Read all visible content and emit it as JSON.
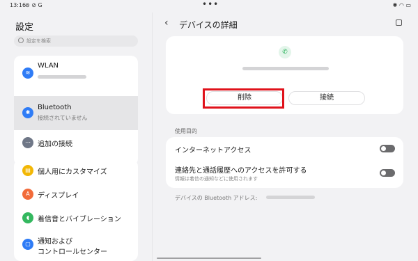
{
  "status": {
    "time": "13:16",
    "left_icons": "⊚ ⊘ G",
    "dots": "•••",
    "right_icons": "✱ ◠ ▭"
  },
  "sidebar": {
    "title": "設定",
    "search_placeholder": "設定を検索",
    "items": [
      {
        "label": "WLAN",
        "sub": "",
        "icon": "wifi-icon",
        "color": "#2f7cf6"
      },
      {
        "label": "Bluetooth",
        "sub": "接続されていません",
        "icon": "bluetooth-icon",
        "color": "#2f7cf6"
      },
      {
        "label": "追加の接続",
        "sub": "",
        "icon": "more-icon",
        "color": "#6f7787"
      },
      {
        "label": "個人用にカスタマイズ",
        "sub": "",
        "icon": "customize-icon",
        "color": "#f2b705"
      },
      {
        "label": "ディスプレイ",
        "sub": "",
        "icon": "display-icon",
        "color": "#f26b3a"
      },
      {
        "label": "着信音とバイブレーション",
        "sub": "",
        "icon": "sound-icon",
        "color": "#34b85f"
      },
      {
        "label": "通知および",
        "sub": "コントロールセンター",
        "icon": "notification-icon",
        "color": "#2f7cf6"
      }
    ],
    "icon_glyphs": [
      "≋",
      "✱",
      "⋯",
      "▤",
      "A",
      "◖",
      "▢"
    ]
  },
  "detail": {
    "title": "デバイスの詳細",
    "delete_label": "削除",
    "connect_label": "接続",
    "section_label": "使用目的",
    "options": [
      {
        "label": "インターネットアクセス",
        "sub": "",
        "enabled": false
      },
      {
        "label": "連絡先と通話履歴へのアクセスを許可する",
        "sub": "情報は着信の通知などに使用されます",
        "enabled": false
      }
    ],
    "address_label": "デバイスの Bluetooth アドレス:",
    "highlight_color": "#e0121b"
  }
}
